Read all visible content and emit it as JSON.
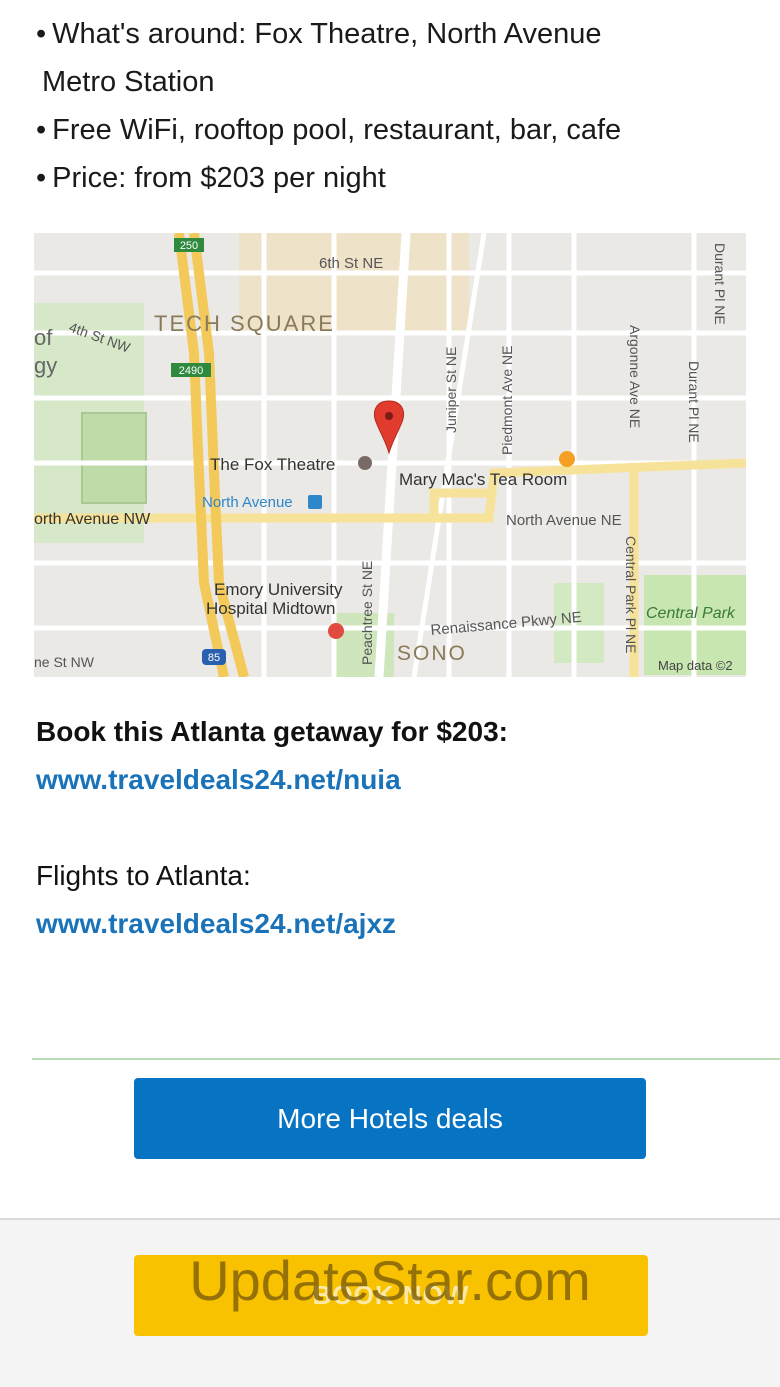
{
  "bullets": [
    {
      "dot": "•",
      "text": "What's around: Fox Theatre, North Avenue"
    },
    {
      "dot": "",
      "text": "Metro Station"
    },
    {
      "dot": "•",
      "text": "Free WiFi, rooftop pool, restaurant, bar, cafe"
    },
    {
      "dot": "•",
      "text": "Price: from $203 per night"
    }
  ],
  "map": {
    "labels": {
      "route_250": "250",
      "route_2490": "2490",
      "route_85": "85",
      "sixth_st": "6th St NE",
      "fourth_st": "4th St NW",
      "of": "of",
      "gy": "gy",
      "tech_square": "TECH SQUARE",
      "juniper": "Juniper St NE",
      "piedmont": "Piedmont Ave NE",
      "argonne": "Argonne Ave NE",
      "durant_1": "Durant Pl NE",
      "durant_2": "Durant Pl NE",
      "fox_theatre": "The Fox Theatre",
      "mary_macs": "Mary Mac's Tea Room",
      "north_avenue_station": "North Avenue",
      "north_avenue_nw": "orth Avenue NW",
      "north_avenue_ne": "North Avenue NE",
      "peachtree": "Peachtree St NE",
      "central_park_pl": "Central Park Pl NE",
      "central_park": "Central Park",
      "emory_1": "Emory University",
      "emory_2": "Hospital Midtown",
      "renaissance": "Renaissance Pkwy NE",
      "sono": "SONO",
      "ne_st_nw": "ne St NW",
      "map_data": "Map data ©2"
    },
    "colors": {
      "highway": "#f3c95a",
      "arterial": "#f7e29a",
      "park": "#c8e6b0",
      "pin": "#e03b2d",
      "water": "#a9d3f0"
    }
  },
  "book": {
    "heading": "Book this Atlanta getaway for $203:",
    "link": "www.traveldeals24.net/nuia"
  },
  "flights": {
    "heading": "Flights to Atlanta:",
    "link": "www.traveldeals24.net/ajxz"
  },
  "buttons": {
    "more_hotels": "More Hotels deals",
    "book_now": "BOOK NOW"
  },
  "watermark": "UpdateStar.com"
}
